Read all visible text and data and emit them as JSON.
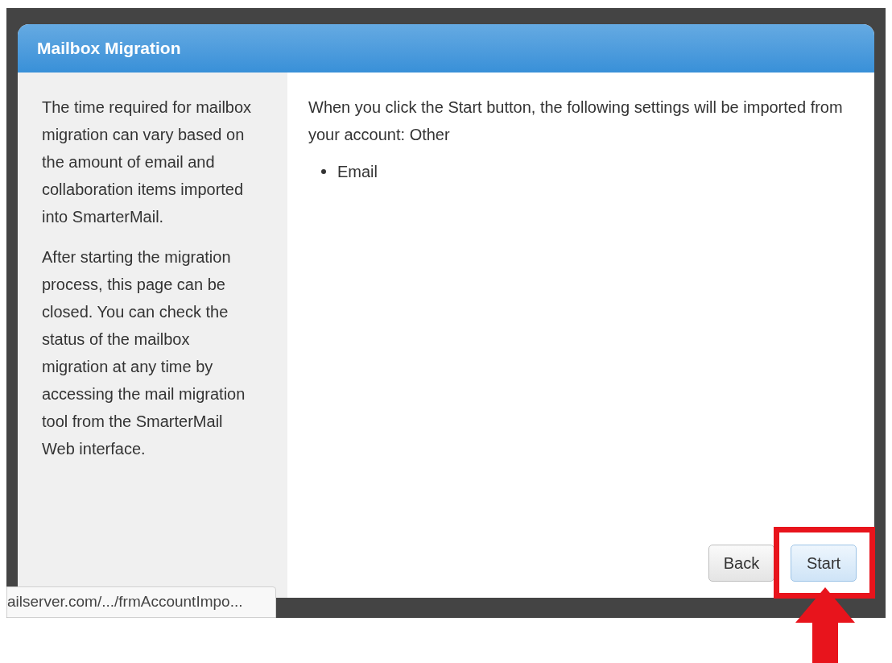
{
  "dialog": {
    "title": "Mailbox Migration"
  },
  "sidebar": {
    "paragraphs": [
      "The time required for mailbox migration can vary based on the amount of email and collaboration items imported into SmarterMail.",
      "After starting the migration process, this page can be closed. You can check the status of the mailbox migration at any time by accessing the mail migration tool from the SmarterMail Web interface."
    ]
  },
  "content": {
    "intro": "When you click the Start button, the following settings will be imported from your account: Other",
    "items": [
      "Email"
    ]
  },
  "buttons": [
    {
      "label": "Back",
      "kind": "secondary"
    },
    {
      "label": "Start",
      "kind": "primary"
    }
  ],
  "status_bar": {
    "url": "ailserver.com/.../frmAccountImpo..."
  }
}
